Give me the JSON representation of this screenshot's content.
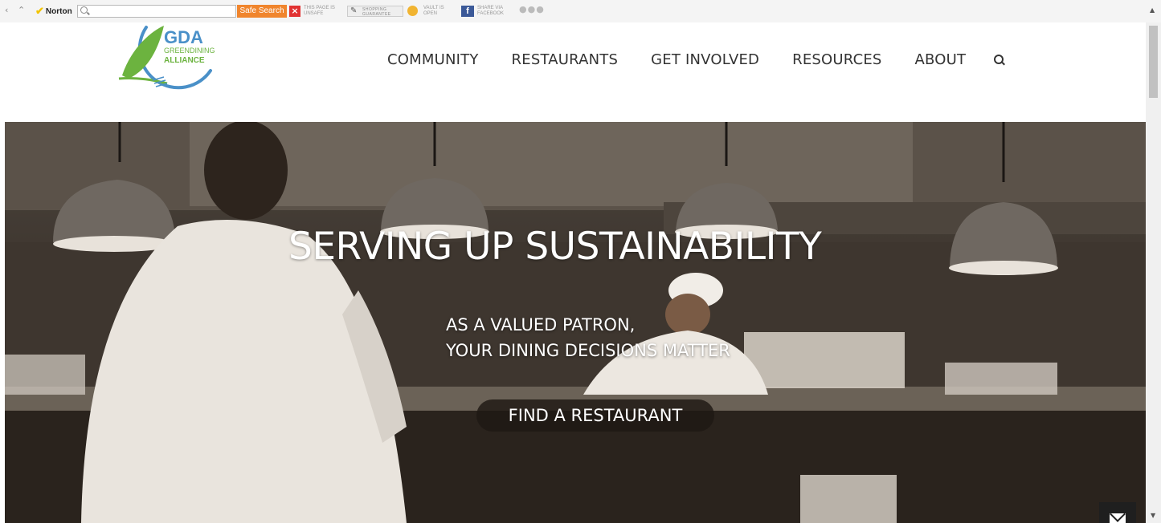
{
  "toolbar": {
    "brand": "Norton",
    "safe_search_label": "Safe Search",
    "page_status": "THIS PAGE IS UNSAFE",
    "shopping": "SHOPPING GUARANTEE",
    "vault": "VAULT IS OPEN",
    "share": "SHARE VIA FACEBOOK",
    "icons": [
      "back-icon",
      "up-icon",
      "norton-check-icon",
      "search-icon",
      "unsafe-x-icon",
      "pen-icon",
      "vault-icon",
      "facebook-icon",
      "more-icon"
    ]
  },
  "site": {
    "logo": {
      "abbr": "GDA",
      "line1": "GREENDINING",
      "line2": "ALLIANCE"
    },
    "nav": [
      "COMMUNITY",
      "RESTAURANTS",
      "GET INVOLVED",
      "RESOURCES",
      "ABOUT"
    ]
  },
  "hero": {
    "title": "SERVING UP SUSTAINABILITY",
    "subtitle_line1": "AS A VALUED PATRON,",
    "subtitle_line2": "YOUR DINING DECISIONS MATTER",
    "cta": "FIND A RESTAURANT"
  },
  "colors": {
    "brand_green": "#6cb33f",
    "brand_blue": "#4a90c8",
    "safe_search": "#f0852d"
  }
}
